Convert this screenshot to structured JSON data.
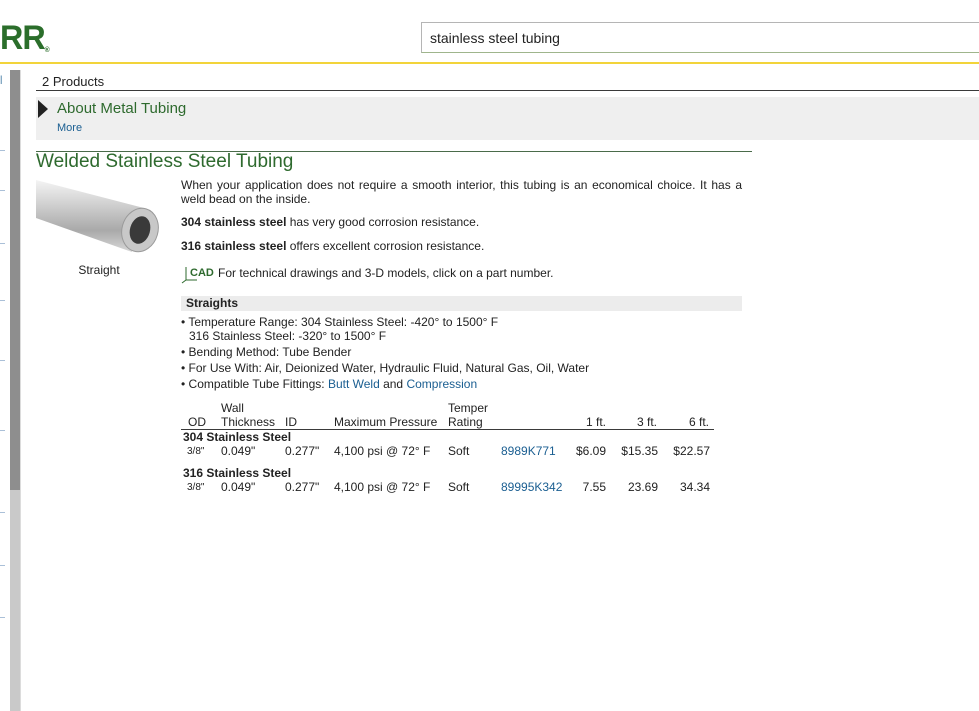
{
  "header": {
    "logo_text": "RR",
    "logo_mark": "®",
    "search_value": "stainless steel tubing",
    "accent_color": "#f2d43a",
    "brand_color": "#2b6e2b"
  },
  "results": {
    "count_label": "2 Products",
    "about_title": "About Metal Tubing",
    "more_label": "More"
  },
  "product": {
    "title": "Welded Stainless Steel Tubing",
    "image_caption": "Straight",
    "description": "When your application does not require a smooth interior, this tubing is an economical choice. It has a weld bead on the inside.",
    "p304_bold": "304 stainless steel",
    "p304_rest": " has very good corrosion resistance.",
    "p316_bold": "316 stainless steel",
    "p316_rest": " offers excellent corrosion resistance.",
    "cad_icon_label": "CAD",
    "cad_text": "For technical drawings and 3-D models, click on a part number.",
    "straights_heading": "Straights",
    "specs": {
      "temp_line1": "• Temperature Range: 304 Stainless Steel: -420° to 1500° F",
      "temp_line2": "316 Stainless Steel: -320° to 1500° F",
      "bending": "• Bending Method: Tube Bender",
      "use_with": "• For Use With: Air, Deionized Water, Hydraulic Fluid, Natural Gas, Oil, Water",
      "fittings_prefix": "• Compatible Tube Fittings: ",
      "fittings_link1": "Butt Weld",
      "fittings_and": " and ",
      "fittings_link2": "Compression"
    },
    "table": {
      "headers": {
        "od": "OD",
        "wall_1": "Wall",
        "wall_2": "Thickness",
        "id": "ID",
        "pressure": "Maximum Pressure",
        "temper_1": "Temper",
        "temper_2": "Rating",
        "ft1": "1 ft.",
        "ft3": "3 ft.",
        "ft6": "6 ft."
      },
      "groups": [
        {
          "name": "304 Stainless Steel",
          "row": {
            "od": "3/8\"",
            "wall": "0.049\"",
            "id": "0.277\"",
            "pressure": "4,100 psi @ 72° F",
            "temper": "Soft",
            "part": "8989K771",
            "p1": "$6.09",
            "p3": "$15.35",
            "p6": "$22.57"
          }
        },
        {
          "name": "316 Stainless Steel",
          "row": {
            "od": "3/8\"",
            "wall": "0.049\"",
            "id": "0.277\"",
            "pressure": "4,100 psi @ 72° F",
            "temper": "Soft",
            "part": "89995K342",
            "p1": "7.55",
            "p3": "23.69",
            "p6": "34.34"
          }
        }
      ]
    }
  }
}
